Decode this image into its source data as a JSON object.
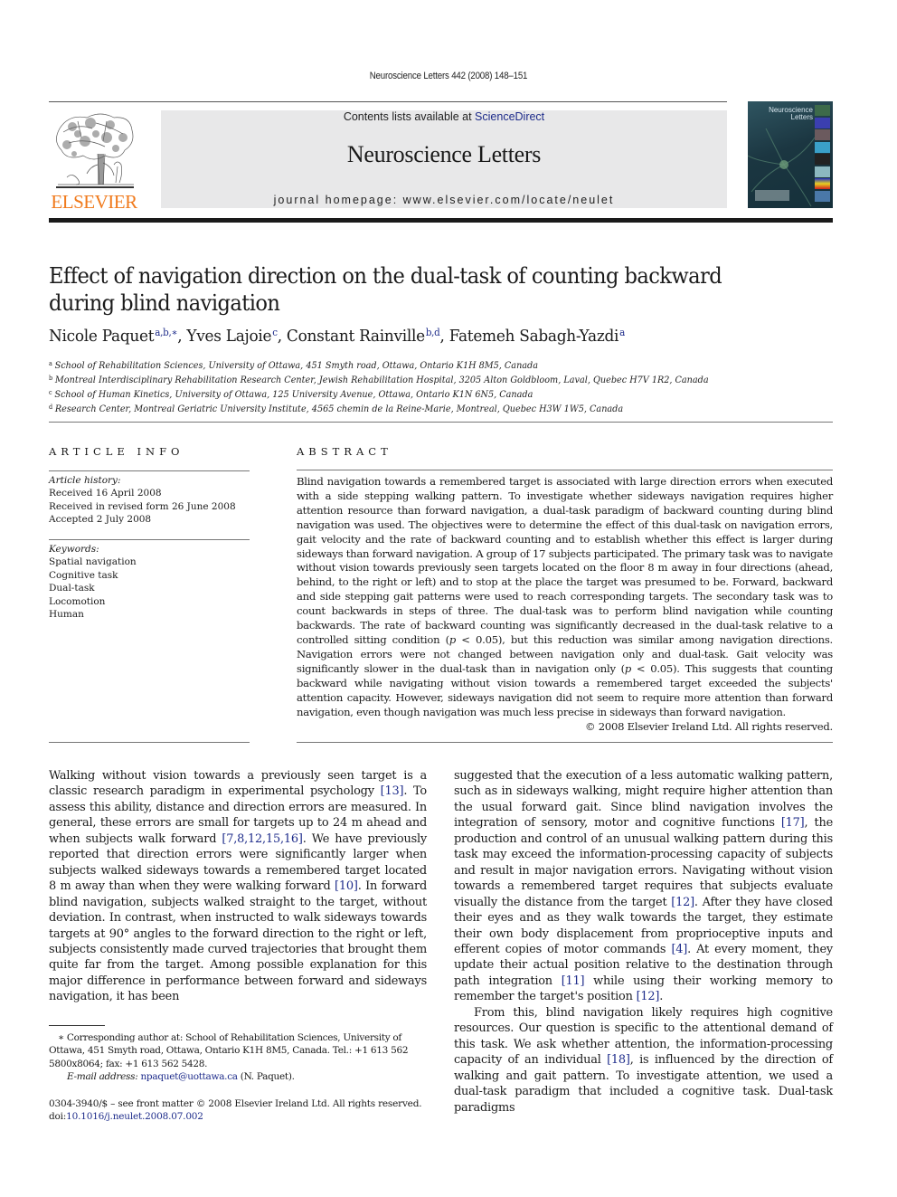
{
  "running_head": "Neuroscience Letters 442 (2008) 148–151",
  "banner": {
    "contents_prefix": "Contents lists available at ",
    "contents_link": "ScienceDirect",
    "journal_title": "Neuroscience Letters",
    "homepage": "journal homepage: www.elsevier.com/locate/neulet"
  },
  "publisher_logo_text": "ELSEVIER",
  "cover": {
    "title_line1": "Neuroscience",
    "title_line2": "Letters"
  },
  "colors": {
    "elsevier_orange": "#f07a1c",
    "link_blue": "#1d2b8a",
    "banner_gray": "#e8e8e9"
  },
  "article": {
    "title": "Effect of navigation direction on the dual-task of counting backward during blind navigation",
    "authors": [
      {
        "name": "Nicole Paquet",
        "sup": "a,b,∗",
        "sep": ", "
      },
      {
        "name": "Yves Lajoie",
        "sup": "c",
        "sep": ", "
      },
      {
        "name": "Constant Rainville",
        "sup": "b,d",
        "sep": ", "
      },
      {
        "name": "Fatemeh Sabagh-Yazdi",
        "sup": "a",
        "sep": ""
      }
    ],
    "affiliations": [
      {
        "key": "a",
        "text": "School of Rehabilitation Sciences, University of Ottawa, 451 Smyth road, Ottawa, Ontario K1H 8M5, Canada"
      },
      {
        "key": "b",
        "text": "Montreal Interdisciplinary Rehabilitation Research Center, Jewish Rehabilitation Hospital, 3205 Alton Goldbloom, Laval, Quebec H7V 1R2, Canada"
      },
      {
        "key": "c",
        "text": "School of Human Kinetics, University of Ottawa, 125 University Avenue, Ottawa, Ontario K1N 6N5, Canada"
      },
      {
        "key": "d",
        "text": "Research Center, Montreal Geriatric University Institute, 4565 chemin de la Reine-Marie, Montreal, Quebec H3W 1W5, Canada"
      }
    ]
  },
  "article_info": {
    "heading": "ARTICLE INFO",
    "history_label": "Article history:",
    "history": [
      "Received 16 April 2008",
      "Received in revised form 26 June 2008",
      "Accepted 2 July 2008"
    ],
    "keywords_label": "Keywords:",
    "keywords": [
      "Spatial navigation",
      "Cognitive task",
      "Dual-task",
      "Locomotion",
      "Human"
    ]
  },
  "abstract": {
    "heading": "ABSTRACT",
    "text_1": "Blind navigation towards a remembered target is associated with large direction errors when executed with a side stepping walking pattern. To investigate whether sideways navigation requires higher attention resource than forward navigation, a dual-task paradigm of backward counting during blind navigation was used. The objectives were to determine the effect of this dual-task on navigation errors, gait velocity and the rate of backward counting and to establish whether this effect is larger during sideways than forward navigation. A group of 17 subjects participated. The primary task was to navigate without vision towards previously seen targets located on the floor 8 m away in four directions (ahead, behind, to the right or left) and to stop at the place the target was presumed to be. Forward, backward and side stepping gait patterns were used to reach corresponding targets. The secondary task was to count backwards in steps of three. The dual-task was to perform blind navigation while counting backwards. The rate of backward counting was significantly decreased in the dual-task relative to a controlled sitting condition (",
    "p_symbol": "p",
    "text_2": " < 0.05), but this reduction was similar among navigation directions. Navigation errors were not changed between navigation only and dual-task. Gait velocity was significantly slower in the dual-task than in navigation only (",
    "text_3": " < 0.05). This suggests that counting backward while navigating without vision towards a remembered target exceeded the subjects' attention capacity. However, sideways navigation did not seem to require more attention than forward navigation, even though navigation was much less precise in sideways than forward navigation.",
    "copyright": "© 2008 Elsevier Ireland Ltd. All rights reserved."
  },
  "body": {
    "left": {
      "t1": "Walking without vision towards a previously seen target is a classic research paradigm in experimental psychology ",
      "r1": "[13]",
      "t2": ". To assess this ability, distance and direction errors are measured. In general, these errors are small for targets up to 24 m ahead and when subjects walk forward ",
      "r2": "[7,8,12,15,16]",
      "t3": ". We have previously reported that direction errors were significantly larger when subjects walked sideways towards a remembered target located 8 m away than when they were walking forward ",
      "r3": "[10]",
      "t4": ". In forward blind navigation, subjects walked straight to the target, without deviation. In contrast, when instructed to walk sideways towards targets at 90° angles to the forward direction to the right or left, subjects consistently made curved trajectories that brought them quite far from the target. Among possible explanation for this major difference in performance between forward and sideways navigation, it has been"
    },
    "right": {
      "t1": "suggested that the execution of a less automatic walking pattern, such as in sideways walking, might require higher attention than the usual forward gait. Since blind navigation involves the integration of sensory, motor and cognitive functions ",
      "r1": "[17]",
      "t2": ", the production and control of an unusual walking pattern during this task may exceed the information-processing capacity of subjects and result in major navigation errors. Navigating without vision towards a remembered target requires that subjects evaluate visually the distance from the target ",
      "r2": "[12]",
      "t3": ". After they have closed their eyes and as they walk towards the target, they estimate their own body displacement from proprioceptive inputs and efferent copies of motor commands ",
      "r3": "[4]",
      "t4": ". At every moment, they update their actual position relative to the destination through path integration ",
      "r4": "[11]",
      "t5": " while using their working memory to remember the target's position ",
      "r5": "[12]",
      "t6": ".",
      "p2_t1": "From this, blind navigation likely requires high cognitive resources. Our question is specific to the attentional demand of this task. We ask whether attention, the information-processing capacity of an individual ",
      "p2_r1": "[18]",
      "p2_t2": ", is influenced by the direction of walking and gait pattern. To investigate attention, we used a dual-task paradigm that included a cognitive task. Dual-task paradigms"
    }
  },
  "footnote": {
    "marker": "∗",
    "text": " Corresponding author at: School of Rehabilitation Sciences, University of Ottawa, 451 Smyth road, Ottawa, Ontario K1H 8M5, Canada. Tel.: +1 613 562 5800x8064; fax: +1 613 562 5428.",
    "email_label": "E-mail address: ",
    "email": "npaquet@uottawa.ca",
    "email_suffix": " (N. Paquet)."
  },
  "frontmatter": {
    "issn_line": "0304-3940/$ – see front matter © 2008 Elsevier Ireland Ltd. All rights reserved.",
    "doi_prefix": "doi:",
    "doi": "10.1016/j.neulet.2008.07.002"
  }
}
